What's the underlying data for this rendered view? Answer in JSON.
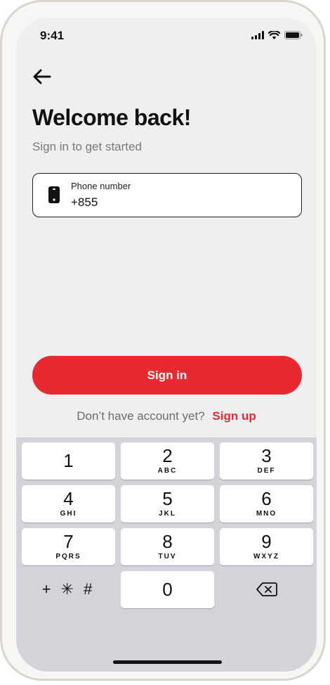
{
  "status_bar": {
    "time": "9:41"
  },
  "header": {
    "title": "Welcome back!",
    "subtitle": "Sign in to get started"
  },
  "phone_field": {
    "label": "Phone number",
    "value": "+855"
  },
  "actions": {
    "signin_label": "Sign in",
    "signup_prompt": "Don’t have account yet?",
    "signup_link": "Sign up"
  },
  "keypad": {
    "keys": [
      {
        "digit": "1",
        "letters": ""
      },
      {
        "digit": "2",
        "letters": "ABC"
      },
      {
        "digit": "3",
        "letters": "DEF"
      },
      {
        "digit": "4",
        "letters": "GHI"
      },
      {
        "digit": "5",
        "letters": "JKL"
      },
      {
        "digit": "6",
        "letters": "MNO"
      },
      {
        "digit": "7",
        "letters": "PQRS"
      },
      {
        "digit": "8",
        "letters": "TUV"
      },
      {
        "digit": "9",
        "letters": "WXYZ"
      },
      {
        "digit": "0",
        "letters": ""
      }
    ],
    "symbols_label": "+ ✳ #",
    "delete_icon": "backspace-icon"
  },
  "colors": {
    "accent": "#e8292f",
    "screen_bg": "#efefef",
    "keyboard_bg": "#d3d4da"
  }
}
